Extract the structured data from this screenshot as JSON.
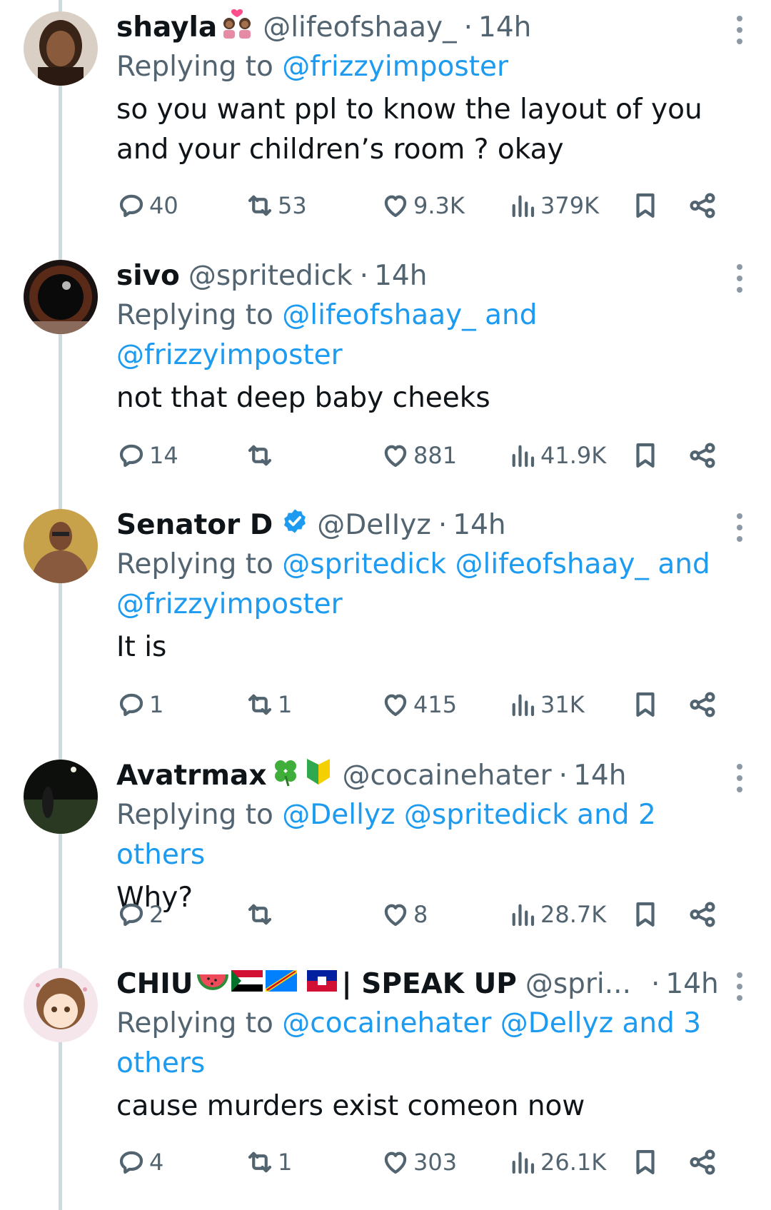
{
  "tweets": [
    {
      "name": "shayla",
      "emoji": "couple-with-heart-emoji",
      "handle": "@lifeofshaay_",
      "dot": "·",
      "time": "14h",
      "replying_prefix": "Replying to",
      "replying_links": "@frizzyimposter",
      "replying_links_2": "",
      "text": "so you want ppl to know the layout of you and your children’s room ? okay",
      "replies": "40",
      "retweets": "53",
      "likes": "9.3K",
      "views": "379K"
    },
    {
      "name": "sivo",
      "handle": "@spritedick",
      "dot": "·",
      "time": "14h",
      "replying_prefix": "Replying to",
      "replying_links": "@lifeofshaay_ and",
      "replying_links_2": "@frizzyimposter",
      "text": "not that deep baby cheeks",
      "replies": "14",
      "retweets": "",
      "likes": "881",
      "views": "41.9K"
    },
    {
      "name": "Senator D",
      "verified": true,
      "handle": "@DeIIyz",
      "dot": "·",
      "time": "14h",
      "replying_prefix": "Replying to",
      "replying_links": "@spritedick @lifeofshaay_ and",
      "replying_links_2": "@frizzyimposter",
      "text": "It is",
      "replies": "1",
      "retweets": "1",
      "likes": "415",
      "views": "31K"
    },
    {
      "name": "Avatrmax",
      "emoji": "four-leaf-clover-and-beginner-emoji",
      "handle": "@cocainehater",
      "dot": "·",
      "time": "14h",
      "replying_prefix": "Replying to",
      "replying_links": "@Dellyz @spritedick and 2 others",
      "replying_links_2": "",
      "text": "Why?",
      "replies": "2",
      "retweets": "",
      "likes": "8",
      "views": "28.7K"
    },
    {
      "name": "CHIU",
      "emoji": "watermelon-and-flags-emoji",
      "name_suffix": "| SPEAK UP",
      "handle": "@spri...",
      "dot": "·",
      "time": "14h",
      "replying_prefix": "Replying to",
      "replying_links": "@cocainehater @Dellyz and 3",
      "replying_links_2": "others",
      "text": "cause murders exist comeon now",
      "replies": "4",
      "retweets": "1",
      "likes": "303",
      "views": "26.1K"
    }
  ],
  "colors": {
    "link": "#1d9bf0",
    "muted": "#536471",
    "thread_line": "#cfd9de",
    "verified": "#1d9bf0"
  }
}
